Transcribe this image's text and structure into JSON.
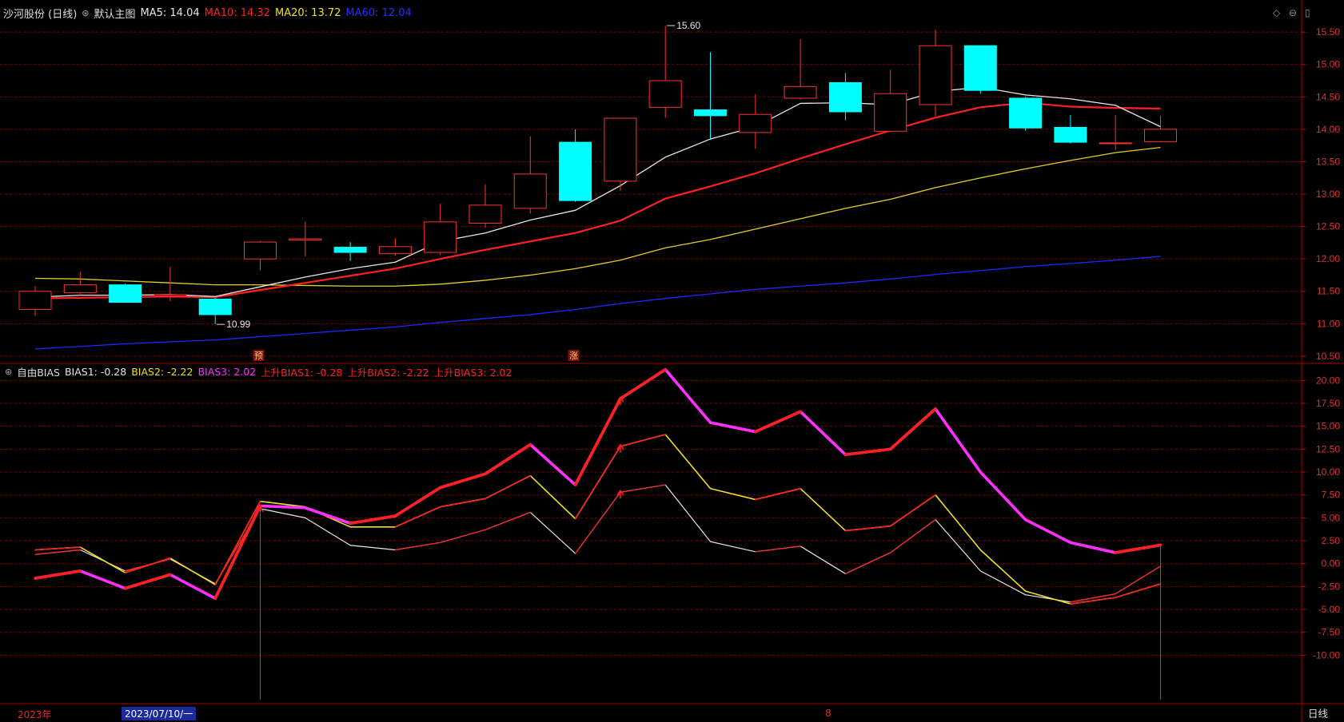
{
  "header": {
    "stock_name": "沙河股份 (日线)",
    "template_name": "默认主图",
    "ma": [
      {
        "label": "MA5: 14.04",
        "color": "#e6e6e6"
      },
      {
        "label": "MA10: 14.32",
        "color": "#ff2020"
      },
      {
        "label": "MA20: 13.72",
        "color": "#f0e020"
      },
      {
        "label": "MA60: 12.04",
        "color": "#2030ff"
      }
    ]
  },
  "indicator": {
    "name": "自由BIAS",
    "labels": [
      {
        "label": "BIAS1: -0.28",
        "color": "#e6e6e6"
      },
      {
        "label": "BIAS2: -2.22",
        "color": "#f0e020"
      },
      {
        "label": "BIAS3: 2.02",
        "color": "#ff30ff"
      },
      {
        "label": "上升BIAS1: -0.28",
        "color": "#ff2020"
      },
      {
        "label": "上升BIAS2: -2.22",
        "color": "#ff2020"
      },
      {
        "label": "上升BIAS3: 2.02",
        "color": "#ff2020"
      }
    ]
  },
  "price_axis": {
    "ticks": [
      "15.50",
      "15.00",
      "14.50",
      "14.00",
      "13.50",
      "13.00",
      "12.50",
      "12.00",
      "11.50",
      "11.00",
      "10.50"
    ],
    "values": [
      15.5,
      15.0,
      14.5,
      14.0,
      13.5,
      13.0,
      12.5,
      12.0,
      11.5,
      11.0,
      10.5
    ]
  },
  "bias_axis": {
    "ticks": [
      "20.00",
      "17.50",
      "15.00",
      "12.50",
      "10.00",
      "7.50",
      "5.00",
      "2.50",
      "0.00",
      "-2.50",
      "-5.00",
      "-7.50",
      "-10.00"
    ],
    "values": [
      20,
      17.5,
      15,
      12.5,
      10,
      7.5,
      5,
      2.5,
      0,
      -2.5,
      -5,
      -7.5,
      -10
    ]
  },
  "annotations": {
    "high": "15.60",
    "low": "10.99",
    "marker1": "预",
    "marker2": "涨"
  },
  "footer": {
    "year": "2023年",
    "date": "2023/07/10/一",
    "month": "8",
    "period": "日线"
  },
  "colors": {
    "up": "#ff3030",
    "down": "#00ffff",
    "ma5": "#e6e6e6",
    "ma10": "#ff2020",
    "ma20": "#e0d020",
    "ma60": "#1a28ff",
    "bias3": "#ff30ff",
    "grid": "#7a0000"
  },
  "chart_data": [
    {
      "type": "candlestick",
      "title": "沙河股份 (日线)",
      "candles": [
        {
          "o": 11.22,
          "h": 11.58,
          "l": 11.12,
          "c": 11.5
        },
        {
          "o": 11.48,
          "h": 11.8,
          "l": 11.44,
          "c": 11.6
        },
        {
          "o": 11.6,
          "h": 11.62,
          "l": 11.35,
          "c": 11.33
        },
        {
          "o": 11.43,
          "h": 11.88,
          "l": 11.35,
          "c": 11.45
        },
        {
          "o": 11.38,
          "h": 11.4,
          "l": 10.99,
          "c": 11.14
        },
        {
          "o": 12.0,
          "h": 12.28,
          "l": 11.82,
          "c": 12.26
        },
        {
          "o": 12.29,
          "h": 12.58,
          "l": 12.04,
          "c": 12.31
        },
        {
          "o": 12.18,
          "h": 12.26,
          "l": 11.97,
          "c": 12.1
        },
        {
          "o": 12.08,
          "h": 12.32,
          "l": 12.05,
          "c": 12.19
        },
        {
          "o": 12.1,
          "h": 12.85,
          "l": 12.06,
          "c": 12.57
        },
        {
          "o": 12.55,
          "h": 13.15,
          "l": 12.48,
          "c": 12.83
        },
        {
          "o": 12.78,
          "h": 13.89,
          "l": 12.7,
          "c": 13.31
        },
        {
          "o": 13.8,
          "h": 14.0,
          "l": 12.88,
          "c": 12.9
        },
        {
          "o": 13.2,
          "h": 14.17,
          "l": 13.05,
          "c": 14.17
        },
        {
          "o": 14.34,
          "h": 15.6,
          "l": 14.18,
          "c": 14.75
        },
        {
          "o": 14.3,
          "h": 15.19,
          "l": 13.84,
          "c": 14.21
        },
        {
          "o": 13.95,
          "h": 14.54,
          "l": 13.7,
          "c": 14.23
        },
        {
          "o": 14.48,
          "h": 15.39,
          "l": 14.46,
          "c": 14.66
        },
        {
          "o": 14.72,
          "h": 14.87,
          "l": 14.14,
          "c": 14.27
        },
        {
          "o": 13.97,
          "h": 14.92,
          "l": 13.96,
          "c": 14.55
        },
        {
          "o": 14.38,
          "h": 15.54,
          "l": 14.2,
          "c": 15.29
        },
        {
          "o": 15.29,
          "h": 15.29,
          "l": 14.55,
          "c": 14.6
        },
        {
          "o": 14.48,
          "h": 14.5,
          "l": 13.98,
          "c": 14.02
        },
        {
          "o": 14.03,
          "h": 14.22,
          "l": 13.78,
          "c": 13.8
        },
        {
          "o": 13.79,
          "h": 14.22,
          "l": 13.68,
          "c": 13.79
        },
        {
          "o": 13.81,
          "h": 14.21,
          "l": 13.8,
          "c": 14.0
        }
      ],
      "ma5": [
        11.41,
        11.44,
        11.44,
        11.45,
        11.42,
        11.57,
        11.72,
        11.85,
        11.95,
        12.27,
        12.4,
        12.6,
        12.75,
        13.13,
        13.57,
        13.85,
        14.04,
        14.4,
        14.41,
        14.38,
        14.58,
        14.65,
        14.53,
        14.47,
        14.37,
        14.04
      ],
      "ma10": [
        11.39,
        11.4,
        11.41,
        11.42,
        11.41,
        11.52,
        11.63,
        11.74,
        11.85,
        12.0,
        12.14,
        12.27,
        12.4,
        12.59,
        12.93,
        13.12,
        13.32,
        13.55,
        13.77,
        13.98,
        14.18,
        14.34,
        14.41,
        14.35,
        14.33,
        14.32
      ],
      "ma20": [
        11.7,
        11.69,
        11.66,
        11.63,
        11.6,
        11.6,
        11.59,
        11.58,
        11.58,
        11.61,
        11.67,
        11.75,
        11.85,
        11.98,
        12.17,
        12.3,
        12.46,
        12.62,
        12.78,
        12.92,
        13.1,
        13.25,
        13.39,
        13.52,
        13.64,
        13.72
      ],
      "ma60": [
        10.61,
        10.65,
        10.69,
        10.72,
        10.75,
        10.8,
        10.85,
        10.9,
        10.95,
        11.02,
        11.08,
        11.14,
        11.22,
        11.31,
        11.39,
        11.46,
        11.53,
        11.58,
        11.63,
        11.69,
        11.76,
        11.82,
        11.88,
        11.93,
        11.98,
        12.04
      ],
      "ylim": [
        10.4,
        15.65
      ]
    },
    {
      "type": "line",
      "title": "自由BIAS",
      "series": [
        {
          "name": "BIAS1",
          "values": [
            1.0,
            1.5,
            -0.8,
            0.5,
            -2.2,
            6.0,
            5.0,
            2.0,
            1.5,
            2.3,
            3.7,
            5.6,
            1.1,
            7.8,
            8.6,
            2.4,
            1.3,
            1.9,
            -1.1,
            1.2,
            4.8,
            -0.8,
            -3.4,
            -4.2,
            -3.3,
            -0.28
          ]
        },
        {
          "name": "BIAS2",
          "values": [
            1.5,
            1.8,
            -1.0,
            0.6,
            -2.3,
            6.8,
            6.2,
            4.0,
            4.0,
            6.2,
            7.1,
            9.6,
            4.9,
            12.8,
            14.1,
            8.2,
            7.0,
            8.2,
            3.6,
            4.1,
            7.5,
            1.5,
            -3.0,
            -4.4,
            -3.7,
            -2.22
          ]
        },
        {
          "name": "BIAS3",
          "values": [
            -1.6,
            -0.8,
            -2.7,
            -1.2,
            -3.8,
            6.3,
            6.1,
            4.4,
            5.2,
            8.3,
            9.8,
            13.0,
            8.6,
            18.0,
            21.2,
            15.4,
            14.4,
            16.6,
            11.9,
            12.5,
            16.9,
            10.0,
            4.8,
            2.3,
            1.2,
            2.02
          ]
        }
      ],
      "ylim": [
        -15.2,
        21.6
      ]
    }
  ]
}
